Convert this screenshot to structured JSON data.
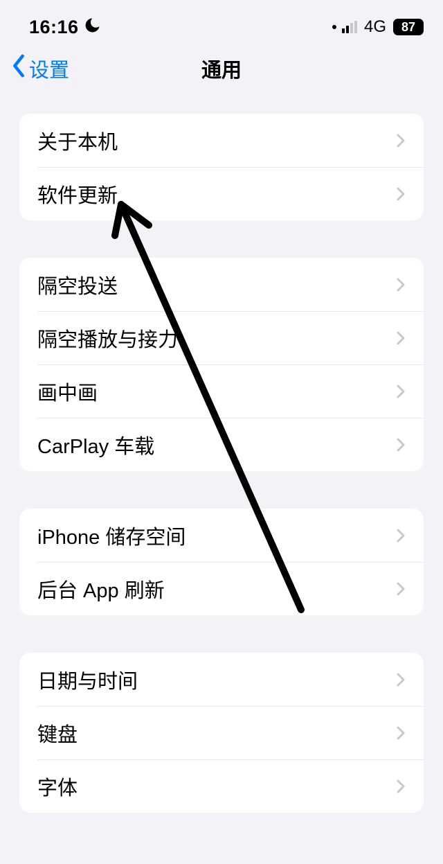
{
  "status": {
    "time": "16:16",
    "network": "4G",
    "battery": "87"
  },
  "nav": {
    "back_label": "设置",
    "title": "通用"
  },
  "groups": [
    {
      "rows": [
        {
          "label": "关于本机"
        },
        {
          "label": "软件更新"
        }
      ]
    },
    {
      "rows": [
        {
          "label": "隔空投送"
        },
        {
          "label": "隔空播放与接力"
        },
        {
          "label": "画中画"
        },
        {
          "label": "CarPlay 车载"
        }
      ]
    },
    {
      "rows": [
        {
          "label": "iPhone 储存空间"
        },
        {
          "label": "后台 App 刷新"
        }
      ]
    },
    {
      "rows": [
        {
          "label": "日期与时间"
        },
        {
          "label": "键盘"
        },
        {
          "label": "字体"
        }
      ]
    }
  ]
}
